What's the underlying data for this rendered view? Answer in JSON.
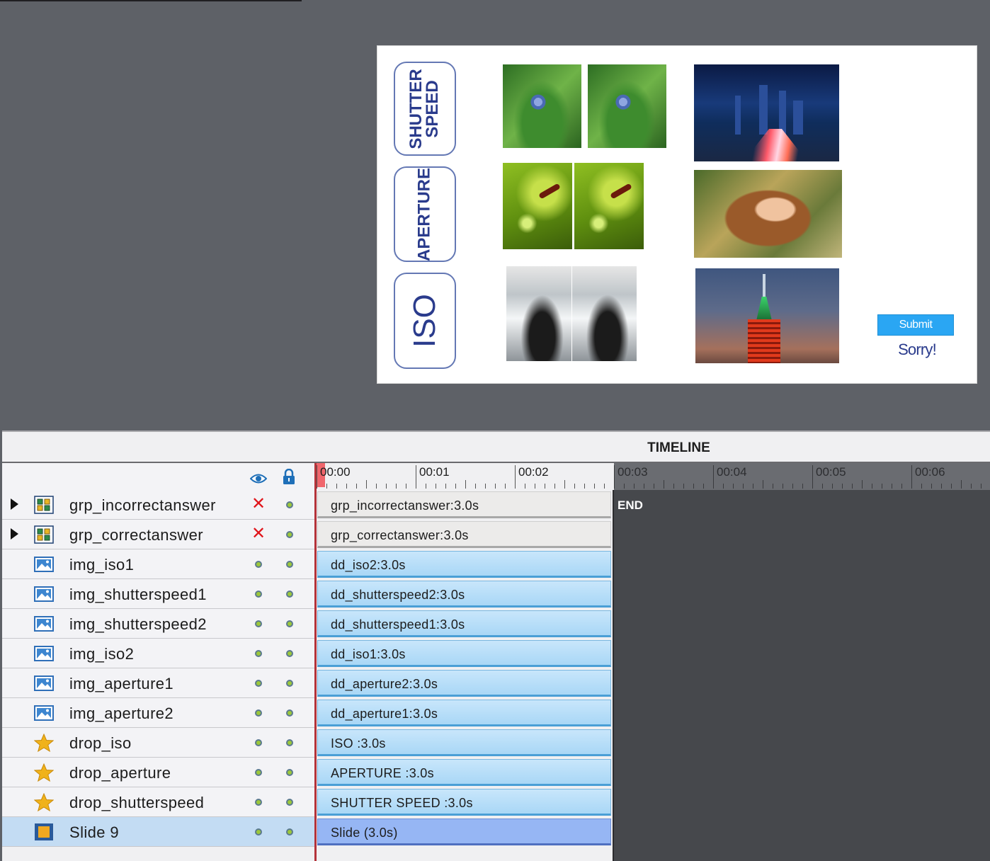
{
  "slide": {
    "labels": {
      "shutter_speed": "SHUTTER\nSPEED",
      "aperture": "APERTURE",
      "iso": "ISO"
    },
    "submit_label": "Submit",
    "feedback_text": "Sorry!"
  },
  "timeline": {
    "title": "TIMELINE",
    "header_icons": [
      "eye-icon",
      "lock-icon"
    ],
    "ruler": [
      "00:00",
      "00:01",
      "00:02",
      "00:03",
      "00:04",
      "00:05",
      "00:06"
    ],
    "end_label": "END",
    "layers": [
      {
        "name": "grp_incorrectanswer",
        "icon": "group-icon",
        "expandable": true,
        "visibility": "hidden",
        "bar": "grp_incorrectanswer:3.0s",
        "bar_style": "gray"
      },
      {
        "name": "grp_correctanswer",
        "icon": "group-icon",
        "expandable": true,
        "visibility": "hidden",
        "bar": "grp_correctanswer:3.0s",
        "bar_style": "gray"
      },
      {
        "name": "img_iso1",
        "icon": "image-icon",
        "expandable": false,
        "visibility": "visible",
        "bar": "dd_iso2:3.0s",
        "bar_style": "blue"
      },
      {
        "name": "img_shutterspeed1",
        "icon": "image-icon",
        "expandable": false,
        "visibility": "visible",
        "bar": "dd_shutterspeed2:3.0s",
        "bar_style": "blue"
      },
      {
        "name": "img_shutterspeed2",
        "icon": "image-icon",
        "expandable": false,
        "visibility": "visible",
        "bar": "dd_shutterspeed1:3.0s",
        "bar_style": "blue"
      },
      {
        "name": "img_iso2",
        "icon": "image-icon",
        "expandable": false,
        "visibility": "visible",
        "bar": "dd_iso1:3.0s",
        "bar_style": "blue"
      },
      {
        "name": "img_aperture1",
        "icon": "image-icon",
        "expandable": false,
        "visibility": "visible",
        "bar": "dd_aperture2:3.0s",
        "bar_style": "blue"
      },
      {
        "name": "img_aperture2",
        "icon": "image-icon",
        "expandable": false,
        "visibility": "visible",
        "bar": "dd_aperture1:3.0s",
        "bar_style": "blue"
      },
      {
        "name": "drop_iso",
        "icon": "star-icon",
        "expandable": false,
        "visibility": "visible",
        "bar": "ISO :3.0s",
        "bar_style": "blue"
      },
      {
        "name": "drop_aperture",
        "icon": "star-icon",
        "expandable": false,
        "visibility": "visible",
        "bar": "APERTURE :3.0s",
        "bar_style": "blue"
      },
      {
        "name": "drop_shutterspeed",
        "icon": "star-icon",
        "expandable": false,
        "visibility": "visible",
        "bar": "SHUTTER  SPEED :3.0s",
        "bar_style": "blue"
      },
      {
        "name": "Slide 9",
        "icon": "slide-icon",
        "expandable": false,
        "visibility": "visible",
        "bar": "Slide (3.0s)",
        "bar_style": "slide",
        "selected": true
      }
    ]
  },
  "colors": {
    "accent": "#2aa6f3",
    "label_text": "#2a3b8c",
    "playhead": "#b4333a",
    "hidden_mark": "#e0141a",
    "visible_dot": "#9cc83a"
  }
}
